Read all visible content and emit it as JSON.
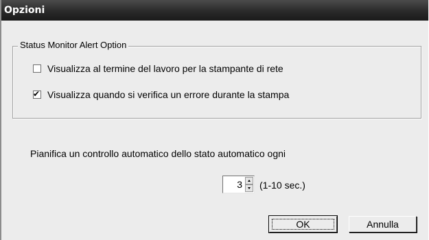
{
  "window": {
    "title": "Opzioni"
  },
  "status_group": {
    "legend": "Status Monitor Alert Option",
    "options": [
      {
        "label": "Visualizza al termine del lavoro per la stampante di rete",
        "checked": false
      },
      {
        "label": "Visualizza quando si verifica un errore durante la stampa",
        "checked": true
      }
    ]
  },
  "schedule": {
    "label": "Pianifica un controllo automatico dello stato automatico ogni",
    "value": "3",
    "range": "(1-10 sec.)"
  },
  "buttons": {
    "ok": "OK",
    "cancel": "Annulla"
  },
  "icons": {
    "checkmark": "✔"
  }
}
